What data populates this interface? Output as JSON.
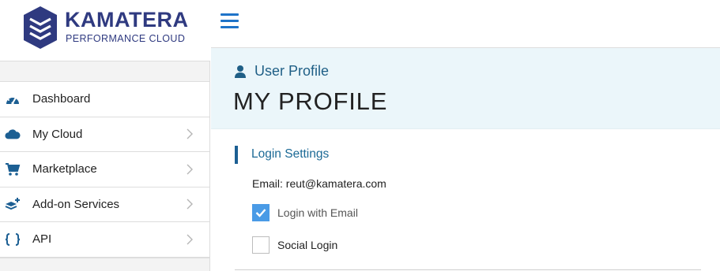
{
  "brand": {
    "name": "KAMATERA",
    "tagline": "PERFORMANCE CLOUD",
    "color": "#2f3a80"
  },
  "sidebar": {
    "items": [
      {
        "label": "Dashboard",
        "icon": "dashboard-gauge-icon",
        "has_submenu": false
      },
      {
        "label": "My Cloud",
        "icon": "cloud-icon",
        "has_submenu": true
      },
      {
        "label": "Marketplace",
        "icon": "shopping-cart-icon",
        "has_submenu": true
      },
      {
        "label": "Add-on Services",
        "icon": "layers-plus-icon",
        "has_submenu": true
      },
      {
        "label": "API",
        "icon": "curly-braces-icon",
        "has_submenu": true
      }
    ]
  },
  "topbar": {
    "menu_icon": "hamburger-menu-icon",
    "accent": "#1e73c8"
  },
  "header": {
    "breadcrumb": "User Profile",
    "breadcrumb_icon": "user-icon",
    "title": "MY PROFILE",
    "background": "#ebf6fa"
  },
  "login_settings": {
    "section_title": "Login Settings",
    "email_text": "Email: reut@kamatera.com",
    "options": [
      {
        "label": "Login with Email",
        "checked": true
      },
      {
        "label": "Social Login",
        "checked": false
      }
    ]
  }
}
